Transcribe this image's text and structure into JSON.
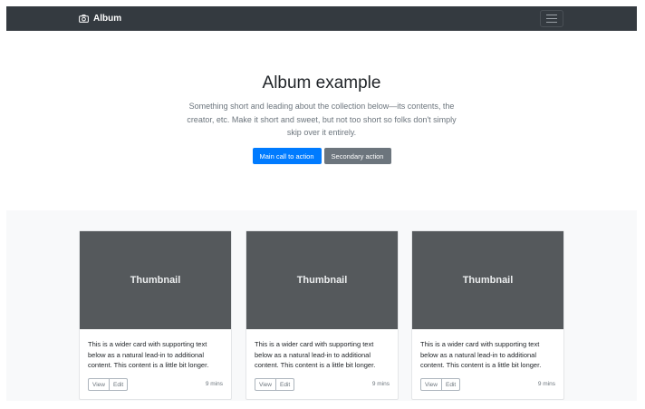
{
  "navbar": {
    "brand": "Album",
    "brand_icon": "camera-icon",
    "toggler_icon": "hamburger-menu-icon"
  },
  "jumbotron": {
    "heading": "Album example",
    "lead": "Something short and leading about the collection below—its contents, the creator, etc. Make it short and sweet, but not too short so folks don't simply skip over it entirely.",
    "primary_action": "Main call to action",
    "secondary_action": "Secondary action"
  },
  "cards": [
    {
      "thumbnail": "Thumbnail",
      "text": "This is a wider card with supporting text below as a natural lead-in to additional content. This content is a little bit longer.",
      "view_label": "View",
      "edit_label": "Edit",
      "time": "9 mins"
    },
    {
      "thumbnail": "Thumbnail",
      "text": "This is a wider card with supporting text below as a natural lead-in to additional content. This content is a little bit longer.",
      "view_label": "View",
      "edit_label": "Edit",
      "time": "9 mins"
    },
    {
      "thumbnail": "Thumbnail",
      "text": "This is a wider card with supporting text below as a natural lead-in to additional content. This content is a little bit longer.",
      "view_label": "View",
      "edit_label": "Edit",
      "time": "9 mins"
    }
  ],
  "colors": {
    "navbar_bg": "#343a40",
    "primary": "#007bff",
    "secondary": "#6c757d",
    "thumbnail_bg": "#55595c",
    "album_bg": "#f8f9fa"
  }
}
